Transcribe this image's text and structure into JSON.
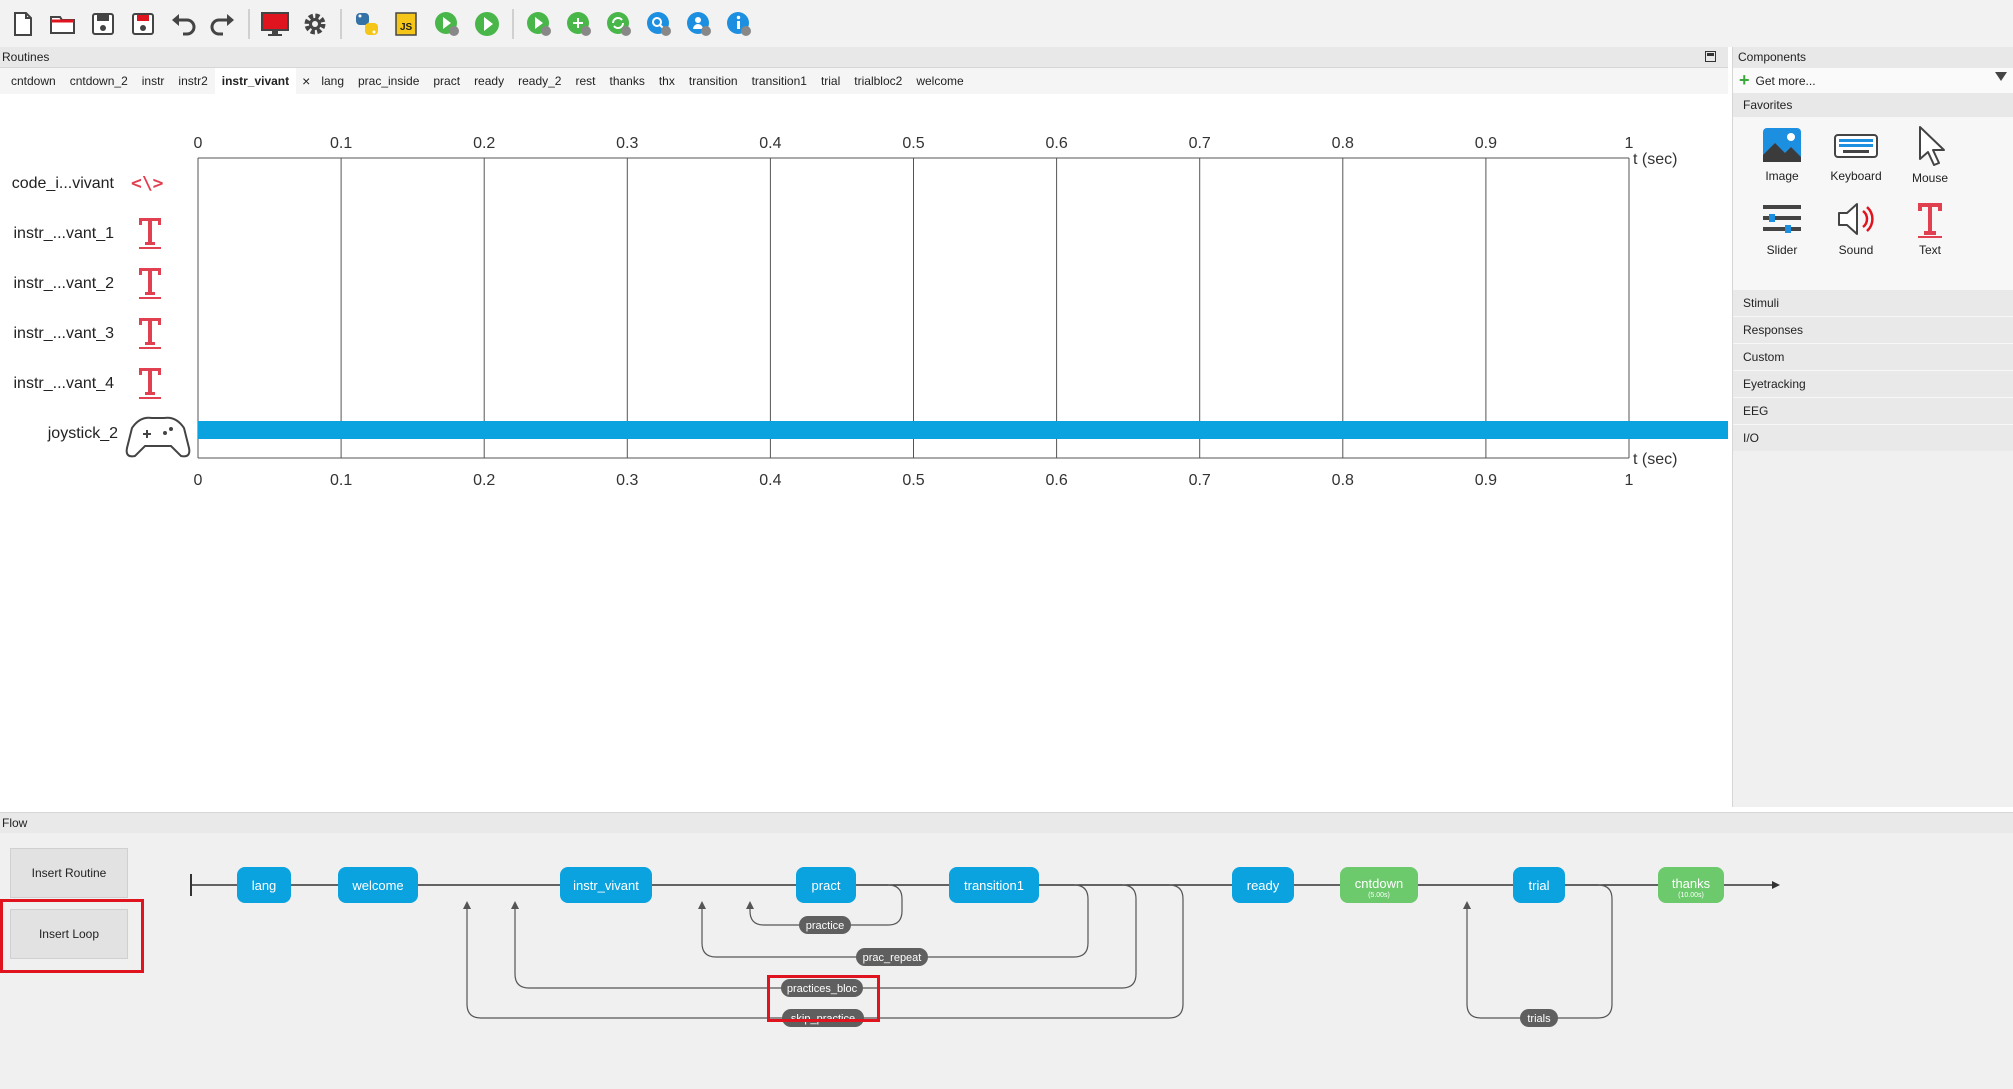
{
  "toolbar": {
    "icons": [
      "new-file",
      "open-folder",
      "save",
      "save-as",
      "undo",
      "redo",
      "monitor",
      "settings",
      "python-export",
      "js-export",
      "run-pilot",
      "run",
      "send-to-runner",
      "compile",
      "sync",
      "search",
      "user",
      "info"
    ]
  },
  "routines": {
    "header": "Routines",
    "tabs": [
      "cntdown",
      "cntdown_2",
      "instr",
      "instr2",
      "instr_vivant",
      "lang",
      "prac_inside",
      "pract",
      "ready",
      "ready_2",
      "rest",
      "thanks",
      "thx",
      "transition",
      "transition1",
      "trial",
      "trialbloc2",
      "welcome"
    ],
    "active_tab": "instr_vivant",
    "close_glyph": "×",
    "components": [
      "code_i...vivant",
      "instr_...vant_1",
      "instr_...vant_2",
      "instr_...vant_3",
      "instr_...vant_4",
      "joystick_2"
    ],
    "axis_ticks": [
      "0",
      "0.1",
      "0.2",
      "0.3",
      "0.4",
      "0.5",
      "0.6",
      "0.7",
      "0.8",
      "0.9",
      "1"
    ],
    "axis_label": "t (sec)",
    "bar_color": "#0aa3e0",
    "joystick_bar": {
      "start": 0,
      "end": 1.07
    }
  },
  "components_panel": {
    "header": "Components",
    "get_more": "Get more...",
    "favorites_label": "Favorites",
    "favorites": [
      {
        "label": "Image",
        "icon": "image-icon"
      },
      {
        "label": "Keyboard",
        "icon": "keyboard-icon"
      },
      {
        "label": "Mouse",
        "icon": "mouse-icon"
      },
      {
        "label": "Slider",
        "icon": "slider-icon"
      },
      {
        "label": "Sound",
        "icon": "sound-icon"
      },
      {
        "label": "Text",
        "icon": "text-icon"
      }
    ],
    "categories": [
      "Stimuli",
      "Responses",
      "Custom",
      "Eyetracking",
      "EEG",
      "I/O"
    ]
  },
  "flow": {
    "header": "Flow",
    "insert_routine": "Insert Routine",
    "insert_loop": "Insert Loop",
    "routines": [
      {
        "label": "lang",
        "color": "#0aa3e0"
      },
      {
        "label": "welcome",
        "color": "#0aa3e0"
      },
      {
        "label": "instr_vivant",
        "color": "#0aa3e0"
      },
      {
        "label": "pract",
        "color": "#0aa3e0"
      },
      {
        "label": "transition1",
        "color": "#0aa3e0"
      },
      {
        "label": "ready",
        "color": "#0aa3e0"
      },
      {
        "label": "cntdown",
        "color": "#6cc96c",
        "sub": "(5.00s)"
      },
      {
        "label": "trial",
        "color": "#0aa3e0"
      },
      {
        "label": "thanks",
        "color": "#6cc96c",
        "sub": "(10.00s)"
      }
    ],
    "loops": [
      "practice",
      "prac_repeat",
      "practices_bloc",
      "skip_practice",
      "trials"
    ]
  }
}
